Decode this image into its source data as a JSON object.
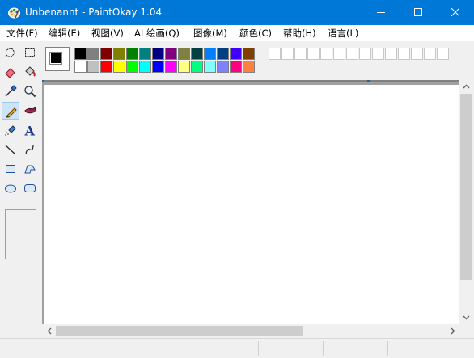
{
  "window": {
    "title": "Unbenannt - PaintOkay 1.04"
  },
  "menu": [
    "文件(F)",
    "编辑(E)",
    "视图(V)",
    "AI 绘画(Q)",
    "图像(M)",
    "颜色(C)",
    "帮助(H)",
    "语言(L)"
  ],
  "toolbox": {
    "tools": [
      {
        "name": "free-select",
        "icon": "lasso-icon"
      },
      {
        "name": "rect-select",
        "icon": "dashed-rect-icon"
      },
      {
        "name": "eraser",
        "icon": "eraser-icon"
      },
      {
        "name": "fill",
        "icon": "paint-bucket-icon"
      },
      {
        "name": "color-picker",
        "icon": "eyedropper-icon"
      },
      {
        "name": "magnifier",
        "icon": "magnifier-icon"
      },
      {
        "name": "pencil",
        "icon": "pencil-icon",
        "active": true
      },
      {
        "name": "brush",
        "icon": "brush-icon"
      },
      {
        "name": "airbrush",
        "icon": "airbrush-icon"
      },
      {
        "name": "text",
        "icon": "text-icon",
        "glyph": "A"
      },
      {
        "name": "line",
        "icon": "line-icon"
      },
      {
        "name": "curve",
        "icon": "curve-icon"
      },
      {
        "name": "rectangle",
        "icon": "rectangle-icon"
      },
      {
        "name": "polygon",
        "icon": "polygon-icon"
      },
      {
        "name": "ellipse",
        "icon": "ellipse-icon"
      },
      {
        "name": "rounded-rectangle",
        "icon": "rounded-rect-icon"
      }
    ]
  },
  "colors": {
    "foreground": "#000000",
    "background": "#ffffff",
    "titlebar": "#0078d7",
    "palette_top": [
      "#000000",
      "#808080",
      "#800000",
      "#808000",
      "#008000",
      "#008080",
      "#000080",
      "#800080",
      "#808040",
      "#004040",
      "#0080ff",
      "#004080",
      "#4000ff",
      "#804000"
    ],
    "palette_bottom": [
      "#ffffff",
      "#c0c0c0",
      "#ff0000",
      "#ffff00",
      "#00ff00",
      "#00ffff",
      "#0000ff",
      "#ff00ff",
      "#ffff80",
      "#00ff80",
      "#80ffff",
      "#8080ff",
      "#ff0080",
      "#ff8040"
    ]
  },
  "status": [
    "",
    "",
    "",
    "",
    ""
  ]
}
